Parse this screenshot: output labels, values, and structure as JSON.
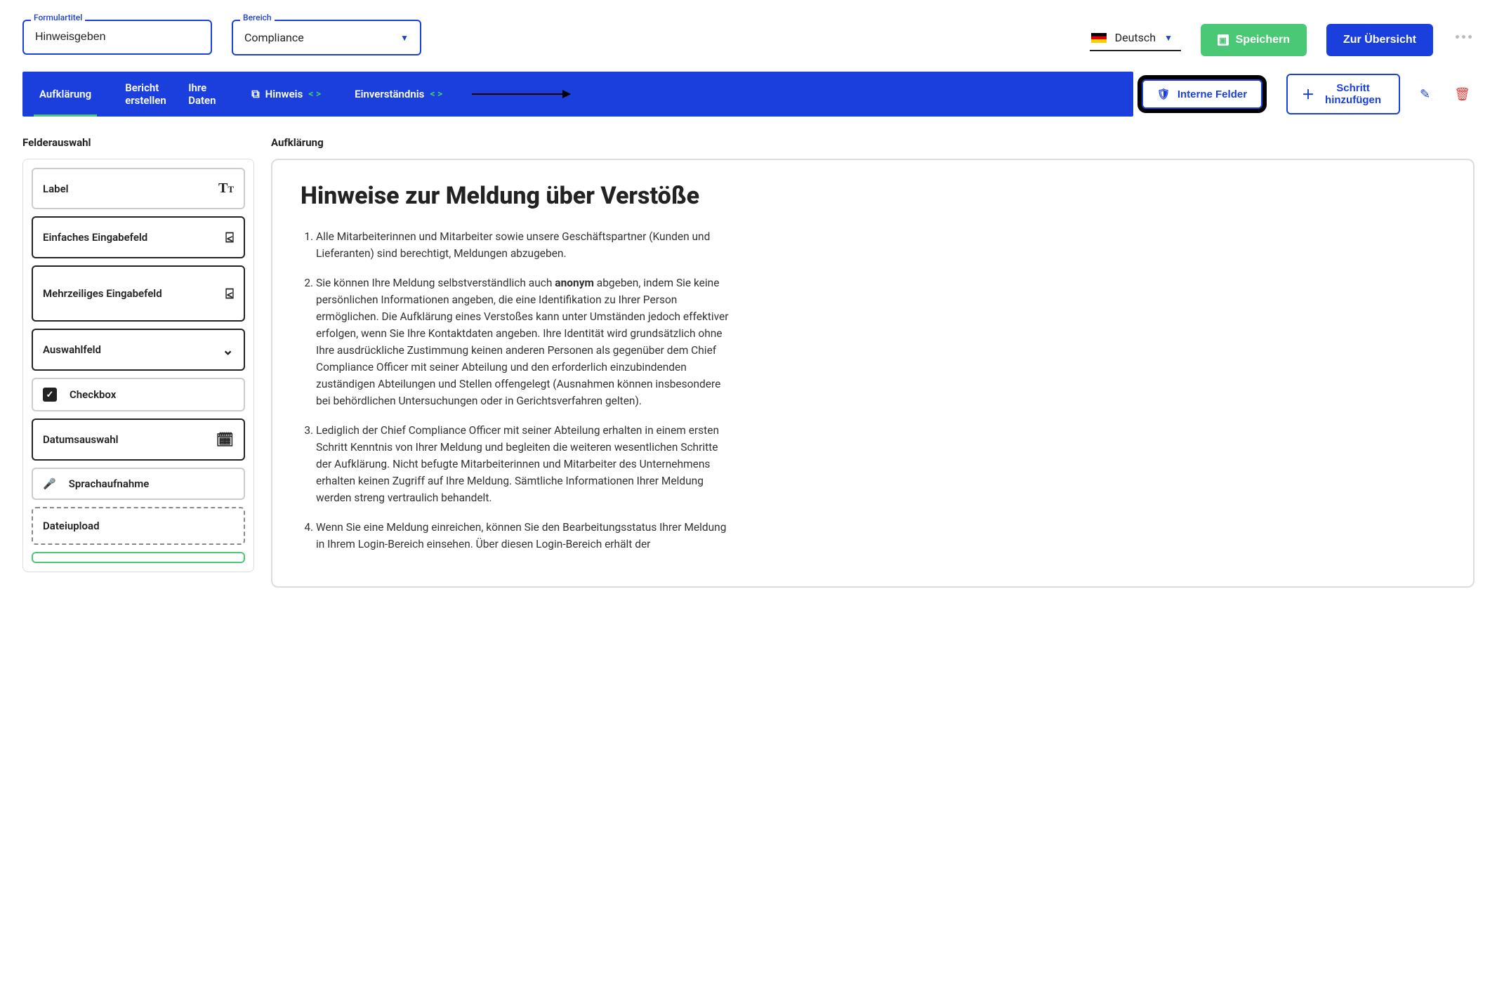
{
  "header": {
    "form_title_label": "Formulartitel",
    "form_title_value": "Hinweisgeben",
    "area_label": "Bereich",
    "area_value": "Compliance",
    "language": "Deutsch",
    "save_label": "Speichern",
    "overview_label": "Zur Übersicht"
  },
  "tabs": {
    "t0": "Aufklärung",
    "t1": "Bericht erstellen",
    "t2": "Ihre Daten",
    "t3": "Hinweis",
    "t4": "Einverständnis",
    "internal_fields": "Interne Felder",
    "add_step": "Schritt hinzufügen"
  },
  "sidebar": {
    "title": "Felderauswahl",
    "opt_label": "Label",
    "opt_simple": "Einfaches Eingabefeld",
    "opt_multi": "Mehrzeiliges Eingabefeld",
    "opt_select": "Auswahlfeld",
    "opt_checkbox": "Checkbox",
    "opt_date": "Datumsauswahl",
    "opt_voice": "Sprachaufnahme",
    "opt_upload": "Dateiupload"
  },
  "content": {
    "section_label": "Aufklärung",
    "heading": "Hinweise zur Meldung über Verstöße",
    "li1": "Alle Mitarbeiterinnen und Mitarbeiter sowie unsere Geschäftspartner (Kunden und Lieferanten) sind berechtigt, Meldungen abzugeben.",
    "li2a": "Sie können Ihre Meldung selbstverständlich auch ",
    "li2b": "anonym",
    "li2c": " abgeben, indem Sie keine persönlichen Informationen angeben, die eine Identifikation zu Ihrer Person ermöglichen. Die Aufklärung eines Verstoßes kann unter Umständen jedoch effektiver erfolgen, wenn Sie Ihre Kontaktdaten angeben. Ihre Identität wird grundsätzlich ohne Ihre ausdrückliche Zustimmung keinen anderen Personen als gegenüber dem Chief Compliance Officer mit seiner Abteilung und den erforderlich einzubindenden zuständigen Abteilungen und Stellen offengelegt (Ausnahmen können insbesondere bei behördlichen Untersuchungen oder in Gerichtsverfahren gelten).",
    "li3": "Lediglich der Chief Compliance Officer mit seiner Abteilung erhalten in einem ersten Schritt Kenntnis von Ihrer Meldung und begleiten die weiteren wesentlichen Schritte der Aufklärung. Nicht befugte Mitarbeiterinnen und Mitarbeiter des Unternehmens erhalten keinen Zugriff auf Ihre Meldung. Sämtliche Informationen Ihrer Meldung werden streng vertraulich behandelt.",
    "li4": "Wenn Sie eine Meldung einreichen, können Sie den Bearbeitungsstatus Ihrer Meldung in Ihrem Login-Bereich einsehen. Über diesen Login-Bereich erhält der"
  }
}
